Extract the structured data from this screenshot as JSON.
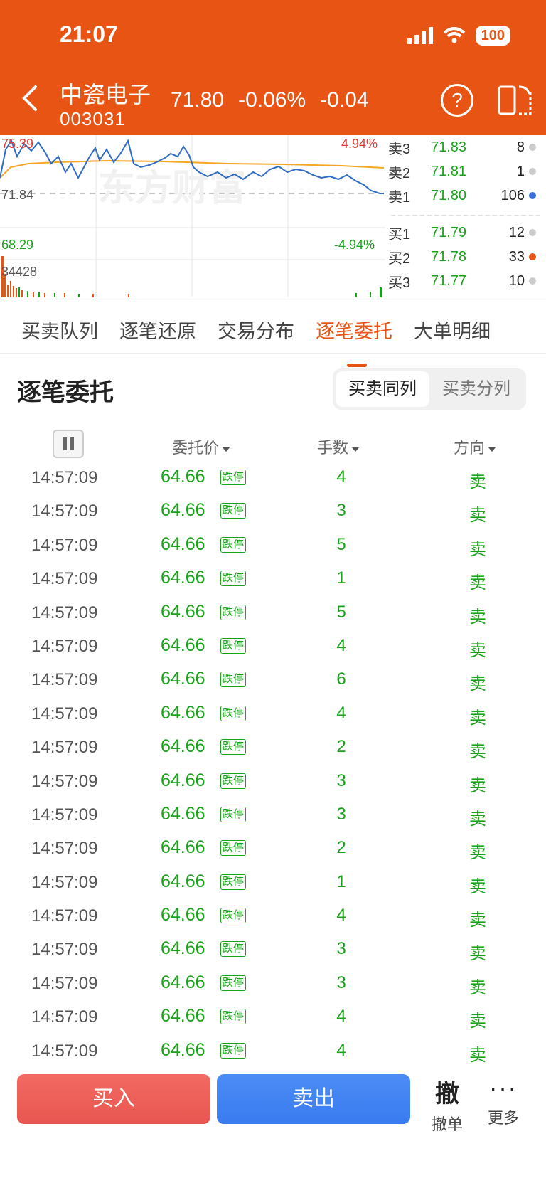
{
  "status_bar": {
    "time": "21:07",
    "battery": "100"
  },
  "stock": {
    "name": "中瓷电子",
    "code": "003031",
    "price": "71.80",
    "change_pct": "-0.06%",
    "change": "-0.04"
  },
  "chart": {
    "high_price": "75.39",
    "mid_price": "71.84",
    "low_price": "68.29",
    "high_pct": "4.94%",
    "low_pct": "-4.94%",
    "volume": "34428",
    "watermark": "东方财富"
  },
  "orderbook": {
    "asks": [
      {
        "label": "卖3",
        "price": "71.83",
        "volume": "8",
        "dot": "#cccccc"
      },
      {
        "label": "卖2",
        "price": "71.81",
        "volume": "1",
        "dot": "#cccccc"
      },
      {
        "label": "卖1",
        "price": "71.80",
        "volume": "106",
        "dot": "#3a6fd6"
      }
    ],
    "bids": [
      {
        "label": "买1",
        "price": "71.79",
        "volume": "12",
        "dot": "#cccccc"
      },
      {
        "label": "买2",
        "price": "71.78",
        "volume": "33",
        "dot": "#e85414"
      },
      {
        "label": "买3",
        "price": "71.77",
        "volume": "10",
        "dot": "#cccccc"
      }
    ]
  },
  "tabs": [
    "买卖队列",
    "逐笔还原",
    "交易分布",
    "逐笔委托",
    "大单明细"
  ],
  "active_tab": 3,
  "section": {
    "title": "逐笔委托",
    "segments": [
      "买卖同列",
      "买卖分列"
    ]
  },
  "columns": {
    "price": "委托价",
    "qty": "手数",
    "direction": "方向"
  },
  "rows": [
    {
      "time": "14:57:09",
      "price": "64.66",
      "badge": "跌停",
      "qty": "4",
      "dir": "卖"
    },
    {
      "time": "14:57:09",
      "price": "64.66",
      "badge": "跌停",
      "qty": "3",
      "dir": "卖"
    },
    {
      "time": "14:57:09",
      "price": "64.66",
      "badge": "跌停",
      "qty": "5",
      "dir": "卖"
    },
    {
      "time": "14:57:09",
      "price": "64.66",
      "badge": "跌停",
      "qty": "1",
      "dir": "卖"
    },
    {
      "time": "14:57:09",
      "price": "64.66",
      "badge": "跌停",
      "qty": "5",
      "dir": "卖"
    },
    {
      "time": "14:57:09",
      "price": "64.66",
      "badge": "跌停",
      "qty": "4",
      "dir": "卖"
    },
    {
      "time": "14:57:09",
      "price": "64.66",
      "badge": "跌停",
      "qty": "6",
      "dir": "卖"
    },
    {
      "time": "14:57:09",
      "price": "64.66",
      "badge": "跌停",
      "qty": "4",
      "dir": "卖"
    },
    {
      "time": "14:57:09",
      "price": "64.66",
      "badge": "跌停",
      "qty": "2",
      "dir": "卖"
    },
    {
      "time": "14:57:09",
      "price": "64.66",
      "badge": "跌停",
      "qty": "3",
      "dir": "卖"
    },
    {
      "time": "14:57:09",
      "price": "64.66",
      "badge": "跌停",
      "qty": "3",
      "dir": "卖"
    },
    {
      "time": "14:57:09",
      "price": "64.66",
      "badge": "跌停",
      "qty": "2",
      "dir": "卖"
    },
    {
      "time": "14:57:09",
      "price": "64.66",
      "badge": "跌停",
      "qty": "1",
      "dir": "卖"
    },
    {
      "time": "14:57:09",
      "price": "64.66",
      "badge": "跌停",
      "qty": "4",
      "dir": "卖"
    },
    {
      "time": "14:57:09",
      "price": "64.66",
      "badge": "跌停",
      "qty": "3",
      "dir": "卖"
    },
    {
      "time": "14:57:09",
      "price": "64.66",
      "badge": "跌停",
      "qty": "3",
      "dir": "卖"
    },
    {
      "time": "14:57:09",
      "price": "64.66",
      "badge": "跌停",
      "qty": "4",
      "dir": "卖"
    },
    {
      "time": "14:57:09",
      "price": "64.66",
      "badge": "跌停",
      "qty": "4",
      "dir": "卖"
    }
  ],
  "actions": {
    "buy": "买入",
    "sell": "卖出",
    "cancel_icon": "撤",
    "cancel": "撤单",
    "more": "更多"
  }
}
